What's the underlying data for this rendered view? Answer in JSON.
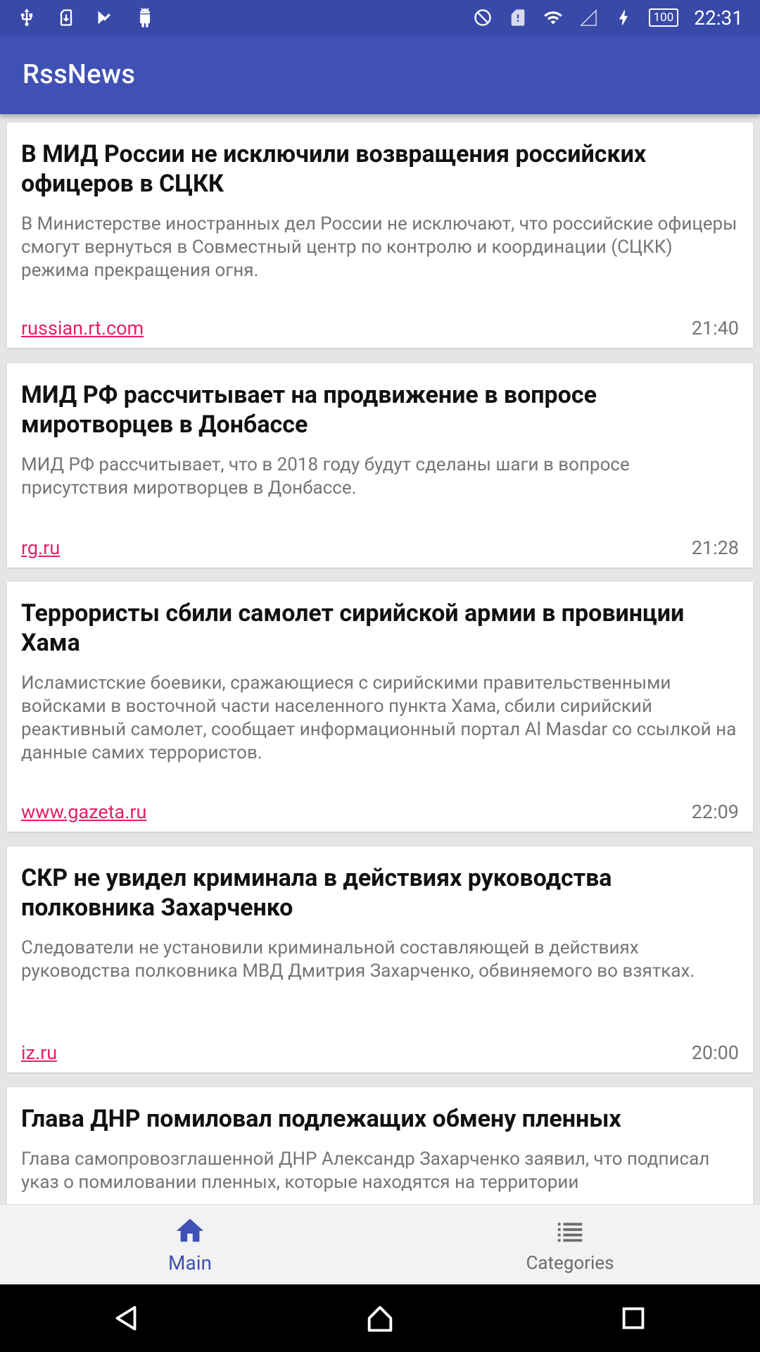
{
  "status_bar": {
    "left_icons": [
      "usb-icon",
      "sim-download-icon",
      "checkmark-flag-icon",
      "android-icon"
    ],
    "right_icons": [
      "do-not-disturb-icon",
      "sim-alert-icon",
      "wifi-icon",
      "signal-icon",
      "charging-icon"
    ],
    "battery": "100",
    "time": "22:31"
  },
  "app_bar": {
    "title": "RssNews"
  },
  "colors": {
    "primary": "#3f51b5",
    "status": "#3849a8",
    "accent": "#e91e63"
  },
  "feed": {
    "items": [
      {
        "title": "В МИД России не исключили возвращения российских офицеров в СЦКК",
        "description": "В Министерстве иностранных дел России не исключают, что российские офицеры смогут вернуться в Совместный центр по контролю и координации (СЦКК) режима прекращения огня.",
        "source": "russian.rt.com",
        "time": "21:40"
      },
      {
        "title": "МИД РФ рассчитывает на продвижение в вопросе миротворцев в Донбассе",
        "description": "МИД РФ рассчитывает, что в 2018 году будут сделаны шаги в вопросе присутствия миротворцев в Донбассе.",
        "source": "rg.ru",
        "time": "21:28"
      },
      {
        "title": "Террористы сбили самолет сирийской армии в провинции Хама",
        "description": "Исламистские боевики, сражающиеся с сирийскими правительственными войсками в восточной части населенного пункта Хама, сбили сирийский реактивный самолет, сообщает информационный портал Al Masdar со ссылкой на данные самих террористов.",
        "source": "www.gazeta.ru",
        "time": "22:09"
      },
      {
        "title": "СКР не увидел криминала в действиях руководства полковника Захарченко",
        "description": "Следователи не установили криминальной составляющей в действиях руководства полковника МВД Дмитрия Захарченко, обвиняемого во взятках.",
        "source": "iz.ru",
        "time": "20:00"
      },
      {
        "title": "Глава ДНР помиловал подлежащих обмену пленных",
        "description": "Глава самопровозглашенной ДНР Александр Захарченко заявил, что подписал указ о помиловании пленных, которые находятся на территории",
        "source": "",
        "time": ""
      }
    ]
  },
  "bottom_nav": {
    "items": [
      {
        "label": "Main",
        "icon": "home-icon",
        "active": true
      },
      {
        "label": "Categories",
        "icon": "list-icon",
        "active": false
      }
    ]
  },
  "system_nav": {
    "buttons": [
      "back-icon",
      "home-circle-icon",
      "recents-icon"
    ]
  }
}
